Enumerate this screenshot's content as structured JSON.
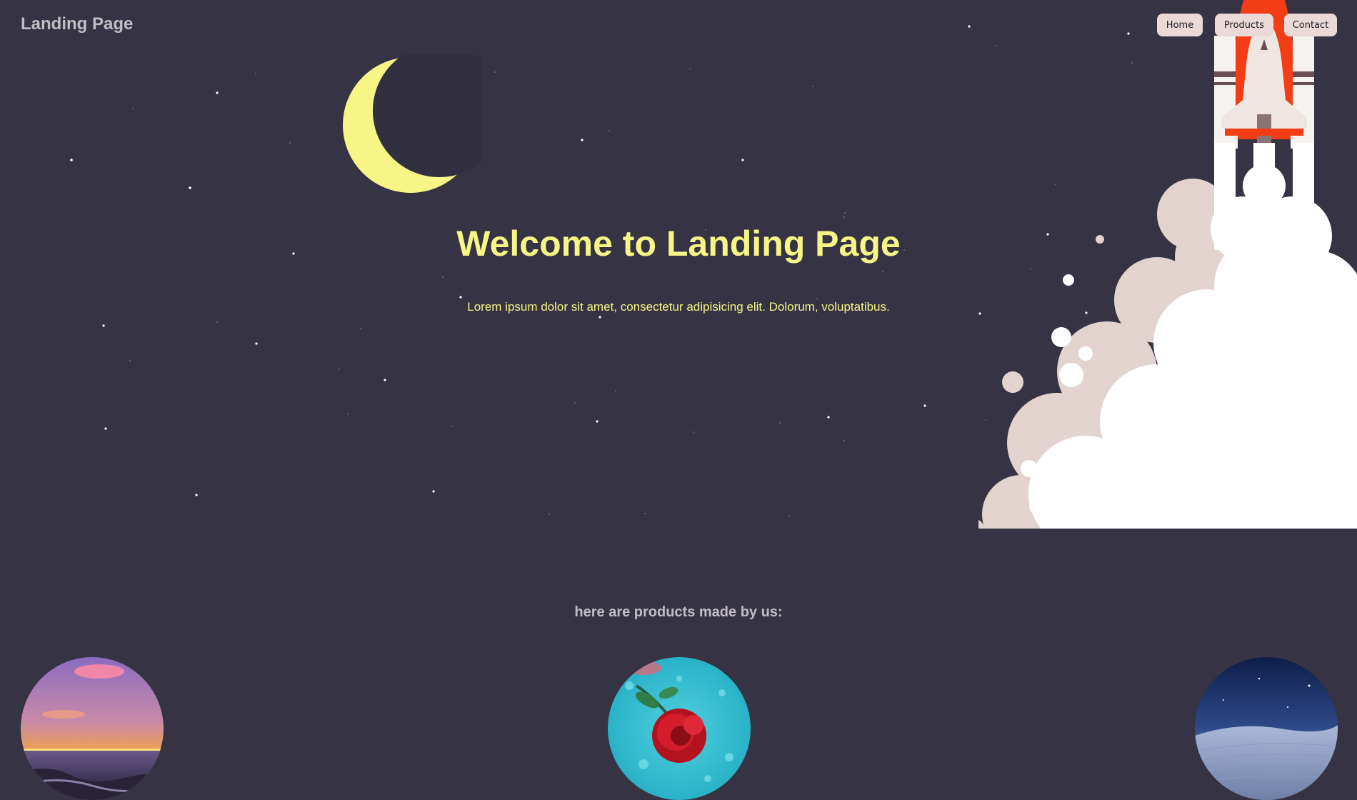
{
  "header": {
    "logo": "Landing Page",
    "nav": [
      {
        "label": "Home"
      },
      {
        "label": "Products"
      },
      {
        "label": "Contact"
      }
    ]
  },
  "hero": {
    "title": "Welcome to Landing Page",
    "subtitle": "Lorem ipsum dolor sit amet, consectetur adipisicing elit. Dolorum, voluptatibus."
  },
  "products": {
    "heading": "here are products made by us:",
    "items": [
      {
        "icon": "sunset-seascape-image"
      },
      {
        "icon": "red-rose-in-water-image"
      },
      {
        "icon": "night-desert-dunes-image"
      }
    ]
  },
  "colors": {
    "background": "#353344",
    "accent_yellow": "#f7f585",
    "nav_button": "#ead9d7",
    "muted_text": "#c2bdc4",
    "rocket_red": "#f23d16"
  }
}
